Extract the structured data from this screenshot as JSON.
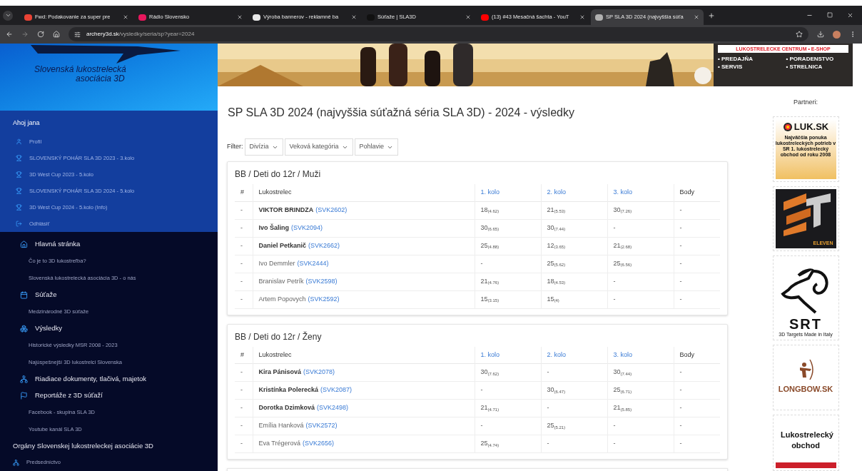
{
  "browser": {
    "tabs": [
      {
        "title": "Fwd: Podakovanie za super pre",
        "kind": "mail",
        "selected": false
      },
      {
        "title": "Rádio Slovensko",
        "kind": "radio",
        "selected": false
      },
      {
        "title": "Výroba bannerov - reklamné ba",
        "kind": "banner",
        "selected": false
      },
      {
        "title": "Súťaže | SLA3D",
        "kind": "site",
        "selected": false
      },
      {
        "title": "(13) #43 Mesačná šachta - YouT",
        "kind": "video",
        "selected": false
      },
      {
        "title": "SP SLA 3D 2024 (najvyššia súťa",
        "kind": "arrow",
        "selected": true
      }
    ],
    "url_domain": "archery3d.sk",
    "url_path": "/vysledky/seria/sp?year=2024"
  },
  "sidebar": {
    "logo_lines": [
      "Slovenská lukostrelecká",
      "asociácia 3D"
    ],
    "greeting": "Ahoj jana",
    "user_menu": [
      {
        "kind": "profile",
        "label": "Profil"
      },
      {
        "kind": "event",
        "label": "SLOVENSKÝ POHÁR SLA 3D 2023 - 3.kolo"
      },
      {
        "kind": "event",
        "label": "3D West Cup 2023 - 5.kolo"
      },
      {
        "kind": "event",
        "label": "SLOVENSKÝ POHÁR SLA 3D 2024 - 5.kolo"
      },
      {
        "kind": "event",
        "label": "3D West Cup 2024 - 5.kolo (Info)"
      },
      {
        "kind": "logout",
        "label": "Odhlásiť"
      }
    ],
    "nav": [
      {
        "kind": "home",
        "label": "Hlavná stránka",
        "children": [
          {
            "label": "Čo je to 3D lukostreľba?"
          },
          {
            "label": "Slovenská lukostrelecká asociácia 3D - o nás"
          }
        ]
      },
      {
        "kind": "events",
        "label": "Súťaže",
        "children": [
          {
            "label": "Medzinárodné 3D súťaže"
          }
        ]
      },
      {
        "kind": "results",
        "label": "Výsledky",
        "children": [
          {
            "label": "Historické výsledky MSR 2008 - 2023"
          },
          {
            "label": "Najúspešnejší 3D lukostrelci Slovenska"
          }
        ]
      },
      {
        "kind": "documents",
        "label": "Riadiace dokumenty, tlačivá, majetok"
      },
      {
        "kind": "reports",
        "label": "Reportáže z 3D súťaží",
        "children": [
          {
            "label": "Facebook - skupina SLA 3D"
          },
          {
            "label": "Youtube kanál SLA 3D"
          }
        ]
      },
      {
        "kind": "section",
        "label": "Orgány Slovenskej lukostreleckej asociácie 3D",
        "children": [
          {
            "label": "Predsedníctvo"
          }
        ]
      }
    ]
  },
  "banner": {
    "kind": "picture",
    "ad_title": "LUKOSTRELECKE CENTRUM • E-SHOP",
    "ad_items": [
      "• PREDAJŇA",
      "• PORADENSTVO",
      "• SERVIS",
      "• STRELNICA"
    ]
  },
  "title": "SP SLA 3D 2024 (najvyššia súťažná séria SLA 3D) - 2024 - výsledky",
  "filter": {
    "label": "Filter:",
    "selects": [
      "Divízia",
      "Veková kategória",
      "Pohlavie"
    ]
  },
  "cards": [
    {
      "title": "BB / Deti do 12r / Muži",
      "columns": [
        {
          "label": "#",
          "link": false
        },
        {
          "label": "Lukostrelec",
          "link": false
        },
        {
          "label": "1. kolo",
          "link": true
        },
        {
          "label": "2. kolo",
          "link": true
        },
        {
          "label": "3. kolo",
          "link": true
        },
        {
          "label": "Body",
          "link": false
        }
      ],
      "rows": [
        {
          "rank": "-",
          "name": "VIKTOR BRINDZA",
          "id": "(SVK2602)",
          "bold": true,
          "scores": [
            "18$_{(4.62)}$",
            "21$_{(5.53)}$",
            "30$_{(7.26)}$"
          ],
          "points": "-"
        },
        {
          "rank": "-",
          "name": "Ivo Šaling",
          "id": "(SVK2094)",
          "bold": true,
          "scores": [
            "30$_{(6.65)}$",
            "30$_{(7.44)}$",
            "-"
          ],
          "points": "-"
        },
        {
          "rank": "-",
          "name": "Daniel Petkanič",
          "id": "(SVK2662)",
          "bold": true,
          "scores": [
            "25$_{(4.88)}$",
            "12$_{(3.65)}$",
            "21$_{(2.68)}$"
          ],
          "points": "-"
        },
        {
          "rank": "-",
          "name": "Ivo Demmler",
          "id": "(SVK2444)",
          "bold": false,
          "scores": [
            "-",
            "25$_{(5.62)}$",
            "25$_{(6.56)}$"
          ],
          "points": "-"
        },
        {
          "rank": "-",
          "name": "Branislav Petrík",
          "id": "(SVK2598)",
          "bold": false,
          "scores": [
            "21$_{(4.76)}$",
            "18$_{(4.53)}$",
            "-"
          ],
          "points": "-"
        },
        {
          "rank": "-",
          "name": "Artem Popovych",
          "id": "(SVK2592)",
          "bold": false,
          "scores": [
            "15$_{(3.15)}$",
            "15$_{(4)}$",
            "-"
          ],
          "points": "-"
        }
      ]
    },
    {
      "title": "BB / Deti do 12r / Ženy",
      "columns": [
        {
          "label": "#",
          "link": false
        },
        {
          "label": "Lukostrelec",
          "link": false
        },
        {
          "label": "1. kolo",
          "link": true
        },
        {
          "label": "2. kolo",
          "link": true
        },
        {
          "label": "3. kolo",
          "link": true
        },
        {
          "label": "Body",
          "link": false
        }
      ],
      "rows": [
        {
          "rank": "-",
          "name": "Kira Pánisová",
          "id": "(SVK2078)",
          "bold": true,
          "scores": [
            "30$_{(7.62)}$",
            "-",
            "30$_{(7.44)}$"
          ],
          "points": "-"
        },
        {
          "rank": "-",
          "name": "Kristínka Polerecká",
          "id": "(SVK2087)",
          "bold": true,
          "scores": [
            "-",
            "30$_{(6.47)}$",
            "25$_{(6.71)}$"
          ],
          "points": "-"
        },
        {
          "rank": "-",
          "name": "Dorotka Dzimková",
          "id": "(SVK2498)",
          "bold": true,
          "scores": [
            "21$_{(4.71)}$",
            "-",
            "21$_{(5.85)}$"
          ],
          "points": "-"
        },
        {
          "rank": "-",
          "name": "Emília Hanková",
          "id": "(SVK2572)",
          "bold": false,
          "scores": [
            "-",
            "25$_{(5.21)}$",
            "-"
          ],
          "points": "-"
        },
        {
          "rank": "-",
          "name": "Eva Trégerová",
          "id": "(SVK2656)",
          "bold": false,
          "scores": [
            "25$_{(4.74)}$",
            "-",
            "-"
          ],
          "points": "-"
        }
      ]
    }
  ],
  "partners": {
    "title": "Partneri:",
    "items": [
      {
        "kind": "lukshop",
        "name": "LUK.SK",
        "tagline": "Najväčšia ponuka lukostreleckých potrieb v SR 1. lukostrelecký obchod od roku 2008"
      },
      {
        "kind": "eleven",
        "name": "ELEVEN"
      },
      {
        "kind": "srt",
        "name": "SRT",
        "tagline": "3D Targets Made in Italy"
      },
      {
        "kind": "longbow",
        "name": "LONGBOW.SK"
      },
      {
        "kind": "shop",
        "name": "Lukostrelecký obchod"
      }
    ]
  }
}
